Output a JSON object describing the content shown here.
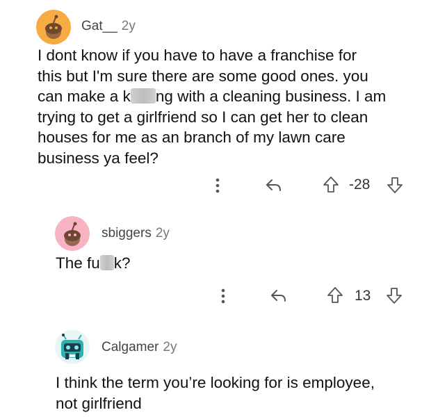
{
  "comments": [
    {
      "username": "Gat__",
      "age": "2y",
      "avatar_icon": "snoo-avatar-orange",
      "avatar_color": "#f5a623",
      "body_lines": [
        "I dont know if you have to have a franchise for",
        "this but I'm sure there are some good ones. you",
        "can make a k",
        "ng with a cleaning business.  I am",
        "trying to get a girlfriend so I can get her to clean",
        "houses for me as an branch of my lawn care",
        "business ya feel?"
      ],
      "score": "-28"
    },
    {
      "username": "sbiggers",
      "age": "2y",
      "avatar_icon": "snoo-avatar-pink",
      "avatar_color": "#f7a8b8",
      "body_pre": "The fu",
      "body_post": "k?",
      "score": "13"
    },
    {
      "username": "Calgamer",
      "age": "2y",
      "avatar_icon": "robot-avatar-teal",
      "avatar_color": "#2bb3b1",
      "body_lines": [
        "I think the term you’re looking for is employee,",
        "not girlfriend"
      ]
    }
  ],
  "icons": {
    "more": "more-vertical-icon",
    "reply": "reply-arrow-icon",
    "upvote": "upvote-arrow-icon",
    "downvote": "downvote-arrow-icon"
  }
}
